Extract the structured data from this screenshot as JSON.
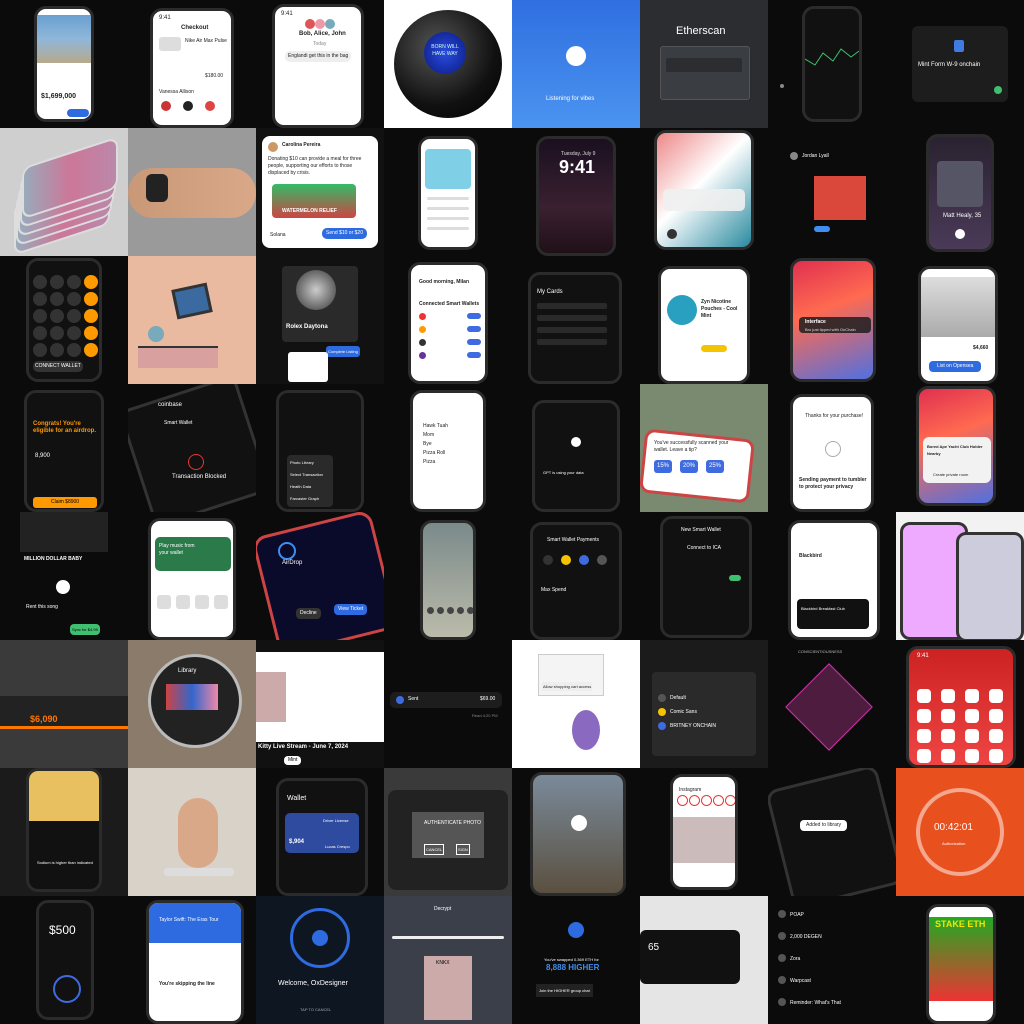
{
  "grid": {
    "tiles": [
      {
        "kind": "home-listing",
        "bg": "#0b0b0b",
        "texts": {
          "price": "$1,699,000"
        }
      },
      {
        "kind": "checkout",
        "bg": "#0b0b0b",
        "texts": {
          "time": "9:41",
          "title": "Checkout",
          "item": "Nike Air Max Pulse",
          "price": "$180.00",
          "seller": "Vanessa Allison"
        }
      },
      {
        "kind": "chat",
        "bg": "#0b0b0b",
        "texts": {
          "time": "9:41",
          "title": "Bob, Alice, John",
          "day": "Today",
          "msg": "Englandi get this in the bag"
        }
      },
      {
        "kind": "magic-8-ball",
        "bg": "#ffffff",
        "texts": {
          "answer": "BORN WILL HAVE WAY"
        }
      },
      {
        "kind": "shazam",
        "bg": "#3b7de0",
        "texts": {
          "listening": "Listening for vibes"
        }
      },
      {
        "kind": "etherscan",
        "bg": "#2b2d31",
        "texts": {
          "logo": "Etherscan"
        }
      },
      {
        "kind": "trading-app",
        "bg": "#0b0b0b",
        "texts": {}
      },
      {
        "kind": "mint-form",
        "bg": "#0b0b0b",
        "texts": {
          "title": "Mint Form W-9 onchain"
        }
      },
      {
        "kind": "phone-stack",
        "bg": "#cfcfcf",
        "texts": {}
      },
      {
        "kind": "handshake-watch",
        "bg": "#9a9a9a",
        "texts": {}
      },
      {
        "kind": "donation-card",
        "bg": "#111111",
        "texts": {
          "name": "Carolina Pereira",
          "body": "Donating $10 can provide a meal for three people, supporting our efforts to those displaced by crisis.",
          "banner": "WATERMELON RELIEF",
          "chain": "Solana",
          "cta": "Send $10 or $20"
        }
      },
      {
        "kind": "nft-profile",
        "bg": "#0b0b0b",
        "texts": {}
      },
      {
        "kind": "lockscreen",
        "bg": "#0b0b0b",
        "texts": {
          "date": "Tuesday, July 9",
          "time": "9:41"
        }
      },
      {
        "kind": "lock-notification",
        "bg": "#0b0b0b",
        "texts": {}
      },
      {
        "kind": "tweet-image",
        "bg": "#0b0b0b",
        "texts": {
          "name": "Jordan Lyall"
        }
      },
      {
        "kind": "music-player",
        "bg": "#0b0b0b",
        "texts": {
          "song": "Matt Healy, 35"
        }
      },
      {
        "kind": "calculator",
        "bg": "#0b0b0b",
        "texts": {
          "button": "CONNECT WALLET"
        }
      },
      {
        "kind": "illustration-room",
        "bg": "#e9b9a0",
        "texts": {}
      },
      {
        "kind": "rolex-listing",
        "bg": "#111111",
        "texts": {
          "name": "Rolex Daytona",
          "cta": "Complete Listing"
        }
      },
      {
        "kind": "banking-app",
        "bg": "#0b0b0b",
        "texts": {
          "greeting": "Good morning, Milan",
          "section": "Connected Smart Wallets"
        }
      },
      {
        "kind": "my-cards",
        "bg": "#0b0b0b",
        "texts": {
          "title": "My Cards"
        }
      },
      {
        "kind": "zyn-shop",
        "bg": "#0b0b0b",
        "texts": {
          "product": "Zyn Nicotine Pouches - Cool Mint"
        }
      },
      {
        "kind": "ios-wallpaper-notif",
        "bg": "#0b0b0b",
        "texts": {
          "app": "Interface",
          "msg": "Bro just tipped with OnChain"
        }
      },
      {
        "kind": "real-estate",
        "bg": "#0b0b0b",
        "texts": {
          "price": "$4,660",
          "cta": "List on Opensea"
        }
      },
      {
        "kind": "airdrop-app",
        "bg": "#0b0b0b",
        "texts": {
          "congrats": "Congrats! You're eligible for an airdrop.",
          "amount": "8,900",
          "cta": "Claim $8900"
        }
      },
      {
        "kind": "coinbase-wallet",
        "bg": "#0b0b0b",
        "texts": {
          "brand": "coinbase",
          "label": "Smart Wallet",
          "status": "Transaction Blocked"
        }
      },
      {
        "kind": "chatgpt-menu",
        "bg": "#0b0b0b",
        "texts": {
          "m1": "Photo Library",
          "m2": "Select Transaction",
          "m3": "Health Data",
          "m4": "Farcaster Graph"
        }
      },
      {
        "kind": "list-app",
        "bg": "#0b0b0b",
        "texts": {
          "i1": "Hawk Tuah",
          "i2": "Mom",
          "i3": "Bye",
          "i4": "Pizza Roll",
          "i5": "Pizza"
        }
      },
      {
        "kind": "chatgpt-sheet",
        "bg": "#0b0b0b",
        "texts": {
          "row": "GPT is using your data"
        }
      },
      {
        "kind": "tip-prompt",
        "bg": "#7a8a70",
        "texts": {
          "q": "You've successfully scanned your wallet. Leave a tip?",
          "p1": "15%",
          "p2": "20%",
          "p3": "25%"
        }
      },
      {
        "kind": "tumbler-payment",
        "bg": "#0b0b0b",
        "texts": {
          "top": "Thanks for your purchase!",
          "main": "Sending payment to tumbler to protect your privacy"
        }
      },
      {
        "kind": "ios-alert",
        "bg": "#0b0b0b",
        "texts": {
          "alert": "Bored Ape Yacht Club Holder Nearby",
          "cta": "Create private room"
        }
      },
      {
        "kind": "music-baby",
        "bg": "#0b0b0b",
        "texts": {
          "title": "MILLION DOLLAR BABY",
          "rent": "Rent this song",
          "price": "Sync for $4.99"
        }
      },
      {
        "kind": "spotify-like",
        "bg": "#0b0b0b",
        "texts": {
          "header": "Play music from your wallet"
        }
      },
      {
        "kind": "airdrop-call",
        "bg": "#0b0b0b",
        "texts": {
          "label": "AirDrop",
          "decline": "Decline",
          "accept": "View Ticket"
        }
      },
      {
        "kind": "video-call",
        "bg": "#0b0b0b",
        "texts": {}
      },
      {
        "kind": "smart-wallet-payments",
        "bg": "#0b0b0b",
        "texts": {
          "title": "Smart Wallet Payments",
          "spend": "Max Spend"
        }
      },
      {
        "kind": "new-smart-wallet",
        "bg": "#0b0b0b",
        "texts": {
          "title": "New Smart Wallet",
          "sub": "Connect to ICA"
        }
      },
      {
        "kind": "blackbird-offer",
        "bg": "#0b0b0b",
        "texts": {
          "brand": "Blackbird",
          "place": "Blackbird Breakfast Club"
        }
      },
      {
        "kind": "home-screens",
        "bg": "#f2f2f2",
        "texts": {}
      },
      {
        "kind": "mattress",
        "bg": "#3a3a3a",
        "texts": {
          "price": "$6,090"
        }
      },
      {
        "kind": "library-device",
        "bg": "#8a7b6a",
        "texts": {
          "title": "Library"
        }
      },
      {
        "kind": "livestream-web",
        "bg": "#111111",
        "texts": {
          "title": "Kitty Live Stream - June 7, 2024",
          "btn": "Mint"
        }
      },
      {
        "kind": "sent-toast",
        "bg": "#0b0b0b",
        "texts": {
          "label": "Sent",
          "amount": "$69.00",
          "time": "Read 4:20 PM"
        }
      },
      {
        "kind": "canvas-sticker",
        "bg": "#ffffff",
        "texts": {
          "btn": "Allow shopping cart access"
        }
      },
      {
        "kind": "account-picker",
        "bg": "#1b1b1b",
        "texts": {
          "a1": "Default",
          "a2": "Comic Sans",
          "a3": "BRITNEY ONCHAIN"
        }
      },
      {
        "kind": "radar-chart",
        "bg": "#0b0b0b",
        "texts": {
          "c": "CONSCIENTIOUSNESS"
        }
      },
      {
        "kind": "ios-homescreen-red",
        "bg": "#0b0b0b",
        "texts": {
          "time": "9:41"
        }
      },
      {
        "kind": "food-label",
        "bg": "#1b1b1b",
        "texts": {
          "warn": "Sodium is higher than indicated"
        }
      },
      {
        "kind": "hand-device",
        "bg": "#d9d2c8",
        "texts": {}
      },
      {
        "kind": "wallet-app",
        "bg": "#0b0b0b",
        "texts": {
          "title": "Wallet",
          "amount": "$,904",
          "card": "Driver License",
          "name": "Lucas Crespo"
        }
      },
      {
        "kind": "camera-auth",
        "bg": "#3a3a3a",
        "texts": {
          "auth": "AUTHENTICATE PHOTO",
          "cancel": "CANCEL",
          "sign": "SIGN"
        }
      },
      {
        "kind": "camera-app",
        "bg": "#0b0b0b",
        "texts": {}
      },
      {
        "kind": "instagram-feed",
        "bg": "#0b0b0b",
        "texts": {
          "brand": "Instagram"
        }
      },
      {
        "kind": "added-library",
        "bg": "#0b0b0b",
        "texts": {
          "toast": "Added to library"
        }
      },
      {
        "kind": "timer-orange",
        "bg": "#e8501e",
        "texts": {
          "time": "00:42:01",
          "label": "Authorization"
        }
      },
      {
        "kind": "payment-500",
        "bg": "#0b0b0b",
        "texts": {
          "amount": "$500"
        }
      },
      {
        "kind": "concert-queue",
        "bg": "#0b0b0b",
        "texts": {
          "title": "Taylor Swift: The Eras Tour",
          "skip": "You're skipping the line"
        }
      },
      {
        "kind": "welcome-designer",
        "bg": "#0e1622",
        "texts": {
          "welcome": "Welcome, OxDesigner",
          "cta": "TAP TO CANCEL"
        }
      },
      {
        "kind": "decrypt-vision",
        "bg": "#3a3f4a",
        "texts": {
          "brand": "Decrypt",
          "name": "KNKX"
        }
      },
      {
        "kind": "swap-success",
        "bg": "#0b0b0b",
        "texts": {
          "msg": "You've swapped 0.369 ETH for",
          "amt": "8,888 HIGHER",
          "join": "Join the HIGHER group chat"
        }
      },
      {
        "kind": "car-dashboard",
        "bg": "#e5e5e5",
        "texts": {
          "speed": "65"
        }
      },
      {
        "kind": "notification-list",
        "bg": "#0b0b0b",
        "texts": {
          "n1": "POAP",
          "n2": "2,000 DEGEN",
          "n3": "Zora",
          "n4": "Warpcast",
          "n5": "Reminder: What's That"
        }
      },
      {
        "kind": "stake-eth",
        "bg": "#0b0b0b",
        "texts": {
          "headline": "STAKE ETH"
        }
      }
    ]
  }
}
